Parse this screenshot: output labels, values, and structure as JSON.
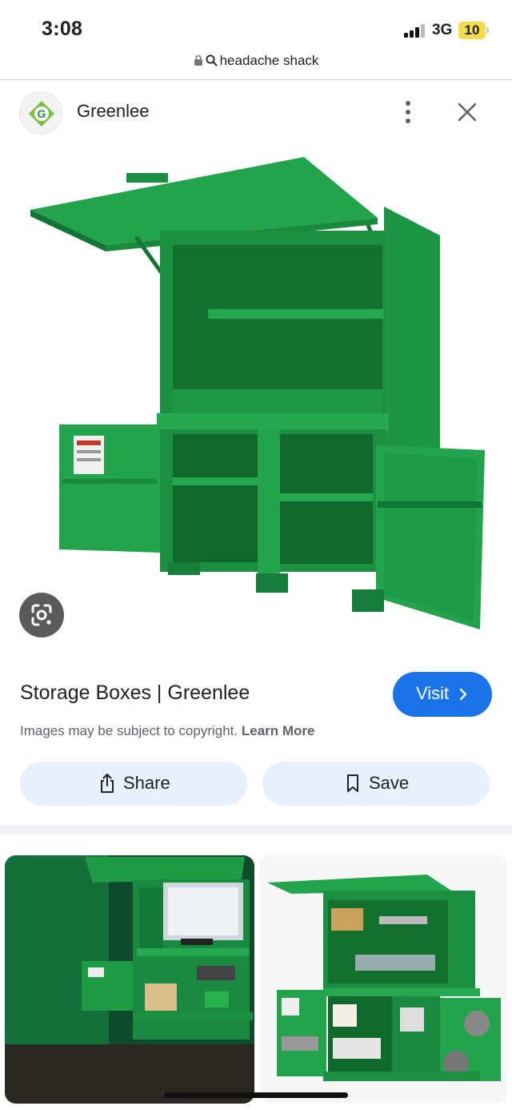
{
  "status_bar": {
    "time": "3:08",
    "network": "3G",
    "battery": "10"
  },
  "browser": {
    "url": "headache shack"
  },
  "source": {
    "name": "Greenlee",
    "logo_letter": "G"
  },
  "result": {
    "title": "Storage Boxes | Greenlee",
    "visit_label": "Visit",
    "copyright_text": "Images may be subject to copyright.",
    "learn_more": "Learn More"
  },
  "actions": {
    "share_label": "Share",
    "save_label": "Save"
  },
  "icons": {
    "lock": "lock-icon",
    "search": "search-icon",
    "more": "more-vert-icon",
    "close": "close-icon",
    "lens": "google-lens-icon",
    "chevron": "chevron-right-icon",
    "share": "share-icon",
    "save": "bookmark-icon"
  },
  "colors": {
    "accent": "#1a73e8",
    "pill_bg": "#e8f0fe",
    "product_green": "#1f9a45",
    "battery": "#f3dc4d"
  }
}
